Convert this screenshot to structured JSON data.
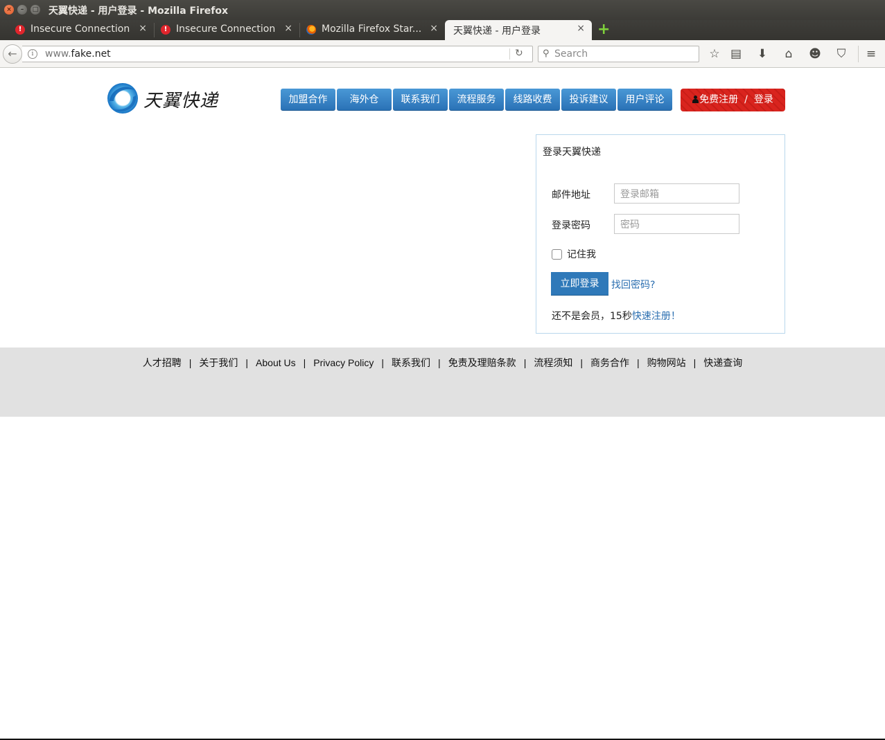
{
  "window": {
    "title": "天翼快递 - 用户登录 - Mozilla Firefox",
    "close_glyph": "×",
    "min_glyph": "–",
    "max_glyph": "□"
  },
  "tabs": [
    {
      "label": "Insecure Connection",
      "icon": "warning-icon",
      "close": "×"
    },
    {
      "label": "Insecure Connection",
      "icon": "warning-icon",
      "close": "×"
    },
    {
      "label": "Mozilla Firefox Star...",
      "icon": "firefox-icon",
      "close": "×"
    },
    {
      "label": "天翼快递 - 用户登录",
      "close": "×",
      "active": true
    }
  ],
  "newtab_glyph": "+",
  "toolbar": {
    "back_glyph": "←",
    "info_glyph": "i",
    "url_prefix": "www.",
    "url_domain": "fake.net",
    "reload_glyph": "↻",
    "search_placeholder": "Search",
    "search_glyph": "⚲",
    "bookmark_star_glyph": "☆",
    "reading_list_glyph": "▤",
    "download_glyph": "⬇",
    "home_glyph": "⌂",
    "chat_glyph": "☻",
    "pocket_glyph": "⛉",
    "menu_glyph": "≡"
  },
  "site": {
    "logo_text": "天翼快递",
    "brand_color": "#2a72b6",
    "nav": [
      "加盟合作",
      "海外仓",
      "联系我们",
      "流程服务",
      "线路收费",
      "投诉建议",
      "用户评论"
    ],
    "register_label": "免费注册",
    "register_sep": "/",
    "login_label": "登录"
  },
  "login": {
    "title": "登录天翼快递",
    "email_label": "邮件地址",
    "email_placeholder": "登录邮箱",
    "password_label": "登录密码",
    "password_placeholder": "密码",
    "remember_label": "记住我",
    "remember_checked": false,
    "submit_label": "立即登录",
    "forgot_label": "找回密码?",
    "not_member_text": "还不是会员，15秒",
    "quick_register_label": "快速注册！"
  },
  "footer": {
    "links": [
      "人才招聘",
      "关于我们",
      "About Us",
      "Privacy Policy",
      "联系我们",
      "免责及理赔条款",
      "流程须知",
      "商务合作",
      "购物网站",
      "快递查询"
    ],
    "separator": "|"
  }
}
